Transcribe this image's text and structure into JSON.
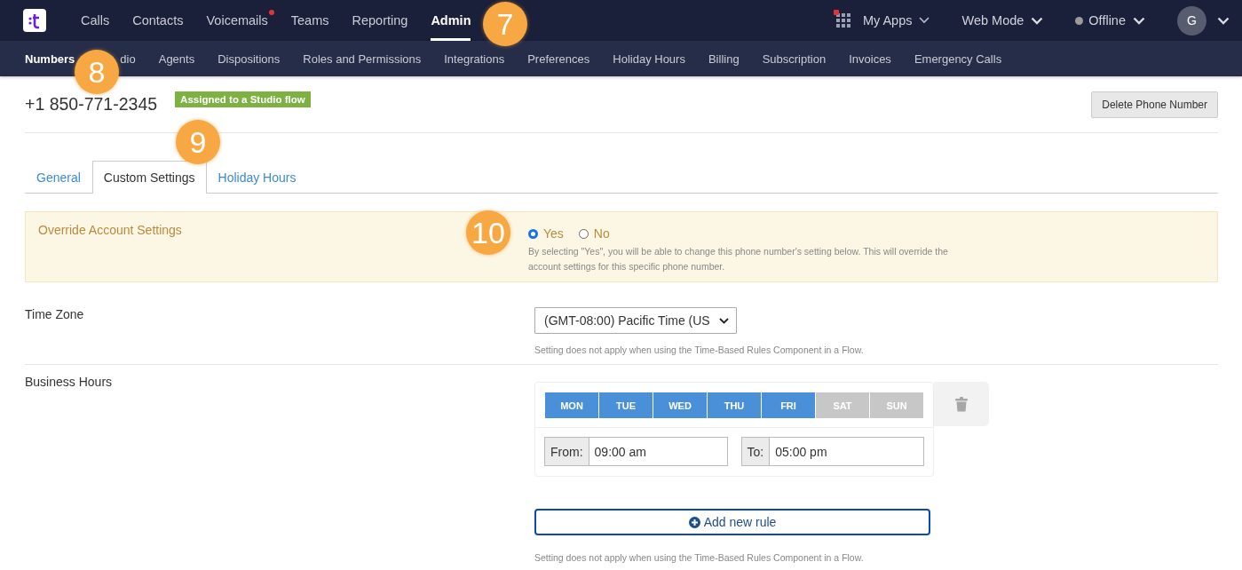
{
  "top_nav": {
    "items": [
      {
        "label": "Calls",
        "selected": false,
        "badge": false
      },
      {
        "label": "Contacts",
        "selected": false,
        "badge": false
      },
      {
        "label": "Voicemails",
        "selected": false,
        "badge": true
      },
      {
        "label": "Teams",
        "selected": false,
        "badge": false
      },
      {
        "label": "Reporting",
        "selected": false,
        "badge": false
      },
      {
        "label": "Admin",
        "selected": true,
        "badge": false
      }
    ],
    "my_apps": {
      "label": "My Apps",
      "badge": true
    },
    "mode": {
      "label": "Web Mode"
    },
    "status": {
      "label": "Offline"
    },
    "avatar": {
      "initial": "G"
    }
  },
  "sub_nav": [
    {
      "label": "Numbers",
      "selected": true
    },
    {
      "label": "dio",
      "selected": false
    },
    {
      "label": "Agents",
      "selected": false
    },
    {
      "label": "Dispositions",
      "selected": false
    },
    {
      "label": "Roles and Permissions",
      "selected": false
    },
    {
      "label": "Integrations",
      "selected": false
    },
    {
      "label": "Preferences",
      "selected": false
    },
    {
      "label": "Holiday Hours",
      "selected": false
    },
    {
      "label": "Billing",
      "selected": false
    },
    {
      "label": "Subscription",
      "selected": false
    },
    {
      "label": "Invoices",
      "selected": false
    },
    {
      "label": "Emergency Calls",
      "selected": false
    }
  ],
  "header": {
    "phone": "+1 850-771-2345",
    "tag": "Assigned to a Studio flow",
    "delete_button": "Delete Phone Number"
  },
  "tabs": [
    {
      "label": "General",
      "selected": false
    },
    {
      "label": "Custom Settings",
      "selected": true
    },
    {
      "label": "Holiday Hours",
      "selected": false
    }
  ],
  "override": {
    "label": "Override Account Settings",
    "options": [
      {
        "label": "Yes",
        "selected": true
      },
      {
        "label": "No",
        "selected": false
      }
    ],
    "help": "By selecting \"Yes\", you will be able to change this phone number's setting below. This will override the account settings for this specific phone number."
  },
  "time_zone": {
    "label": "Time Zone",
    "value": "(GMT-08:00) Pacific Time (US",
    "help": "Setting does not apply when using the Time-Based Rules Component in a Flow."
  },
  "business_hours": {
    "label": "Business Hours",
    "days": [
      {
        "label": "MON",
        "selected": true
      },
      {
        "label": "TUE",
        "selected": true
      },
      {
        "label": "WED",
        "selected": true
      },
      {
        "label": "THU",
        "selected": true
      },
      {
        "label": "FRI",
        "selected": true
      },
      {
        "label": "SAT",
        "selected": false
      },
      {
        "label": "SUN",
        "selected": false
      }
    ],
    "from_label": "From:",
    "from_value": "09:00 am",
    "to_label": "To:",
    "to_value": "05:00 pm",
    "add_button": "Add new rule",
    "help": "Setting does not apply when using the Time-Based Rules Component in a Flow."
  },
  "callouts": [
    {
      "number": "7"
    },
    {
      "number": "8"
    },
    {
      "number": "9"
    },
    {
      "number": "10"
    }
  ]
}
